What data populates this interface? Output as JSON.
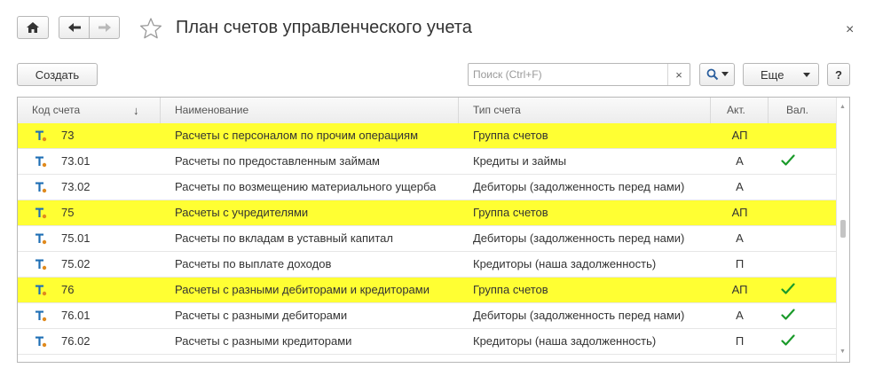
{
  "window": {
    "title": "План счетов управленческого учета",
    "close_glyph": "×"
  },
  "toolbar": {
    "create_label": "Создать",
    "search_placeholder": "Поиск (Ctrl+F)",
    "search_clear_glyph": "×",
    "more_label": "Еще",
    "help_label": "?"
  },
  "table": {
    "columns": [
      "Код счета",
      "Наименование",
      "Тип счета",
      "Акт.",
      "Вал."
    ],
    "sort_indicator": "↓",
    "rows": [
      {
        "code": "73",
        "name": "Расчеты с персоналом по прочим операциям",
        "type": "Группа счетов",
        "act": "АП",
        "currency": false,
        "group": true
      },
      {
        "code": "73.01",
        "name": "Расчеты по предоставленным займам",
        "type": "Кредиты и займы",
        "act": "А",
        "currency": true,
        "group": false
      },
      {
        "code": "73.02",
        "name": "Расчеты по возмещению материального ущерба",
        "type": "Дебиторы (задолженность перед нами)",
        "act": "А",
        "currency": false,
        "group": false
      },
      {
        "code": "75",
        "name": "Расчеты с учредителями",
        "type": "Группа счетов",
        "act": "АП",
        "currency": false,
        "group": true
      },
      {
        "code": "75.01",
        "name": "Расчеты по вкладам в уставный капитал",
        "type": "Дебиторы (задолженность перед нами)",
        "act": "А",
        "currency": false,
        "group": false
      },
      {
        "code": "75.02",
        "name": "Расчеты по выплате доходов",
        "type": "Кредиторы (наша задолженность)",
        "act": "П",
        "currency": false,
        "group": false
      },
      {
        "code": "76",
        "name": "Расчеты с разными дебиторами и кредиторами",
        "type": "Группа счетов",
        "act": "АП",
        "currency": true,
        "group": true
      },
      {
        "code": "76.01",
        "name": "Расчеты с разными дебиторами",
        "type": "Дебиторы (задолженность перед нами)",
        "act": "А",
        "currency": true,
        "group": false
      },
      {
        "code": "76.02",
        "name": "Расчеты с разными кредиторами",
        "type": "Кредиторы (наша задолженность)",
        "act": "П",
        "currency": true,
        "group": false
      }
    ]
  },
  "colors": {
    "group_highlight": "#ffff33",
    "check": "#1a9a2a",
    "icon_blue": "#1f6fb5",
    "icon_orange": "#e08a1e"
  }
}
